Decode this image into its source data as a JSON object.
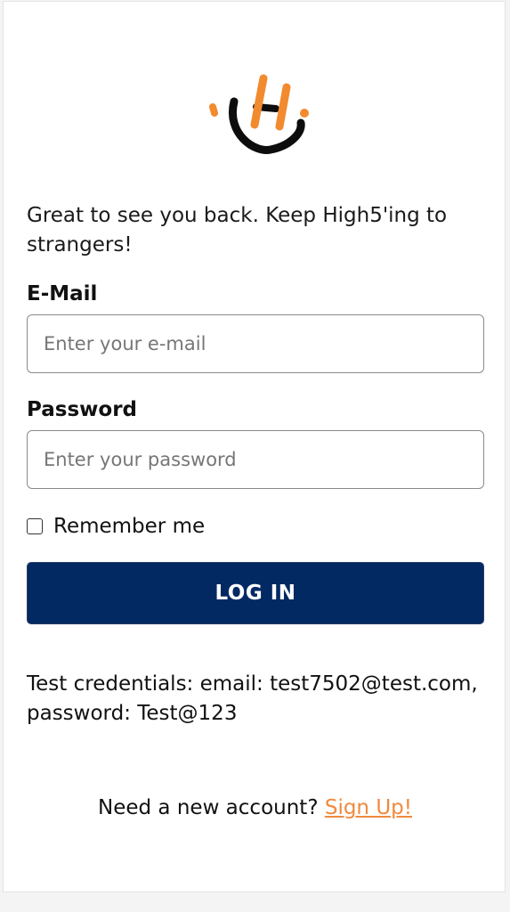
{
  "brand": {
    "accent_color": "#f28a2e",
    "dark_color": "#0d0d0d",
    "button_color": "#032963",
    "link_color": "#f08a3e"
  },
  "greeting": "Great to see you back. Keep High5'ing to strangers!",
  "email": {
    "label": "E-Mail",
    "placeholder": "Enter your e-mail",
    "value": ""
  },
  "password": {
    "label": "Password",
    "placeholder": "Enter your password",
    "value": ""
  },
  "remember": {
    "label": "Remember me",
    "checked": false
  },
  "login_button": "LOG IN",
  "test_credentials": "Test credentials: email: test7502@test.com, password: Test@123",
  "signup": {
    "prompt": "Need a new account?",
    "link": "Sign Up!"
  }
}
